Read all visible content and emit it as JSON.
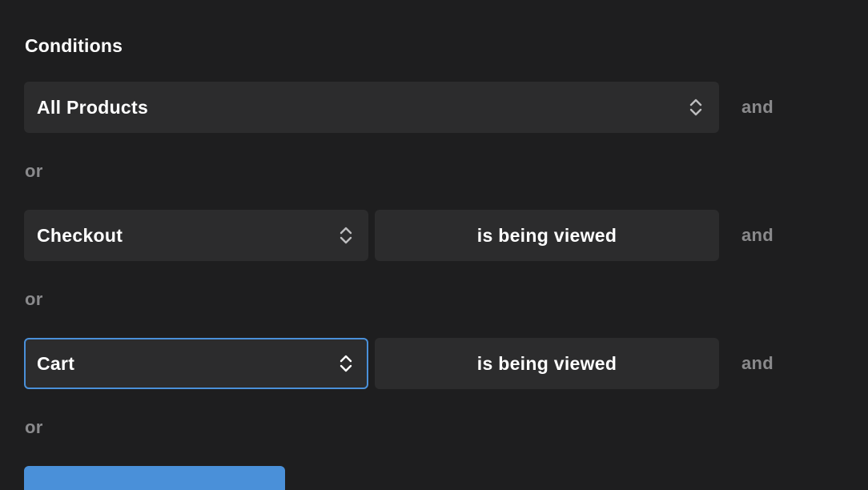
{
  "conditions": {
    "title": "Conditions",
    "rows": [
      {
        "select_value": "All Products",
        "and_label": "and"
      },
      {
        "select_value": "Checkout",
        "state_value": "is being viewed",
        "and_label": "and"
      },
      {
        "select_value": "Cart",
        "state_value": "is being viewed",
        "and_label": "and"
      }
    ],
    "or_label": "or",
    "colors": {
      "background": "#1e1e1f",
      "control": "#2c2c2d",
      "muted_text": "#8a8a8c",
      "focus_accent": "#4a90d9",
      "primary_button": "#4a90d9"
    }
  }
}
